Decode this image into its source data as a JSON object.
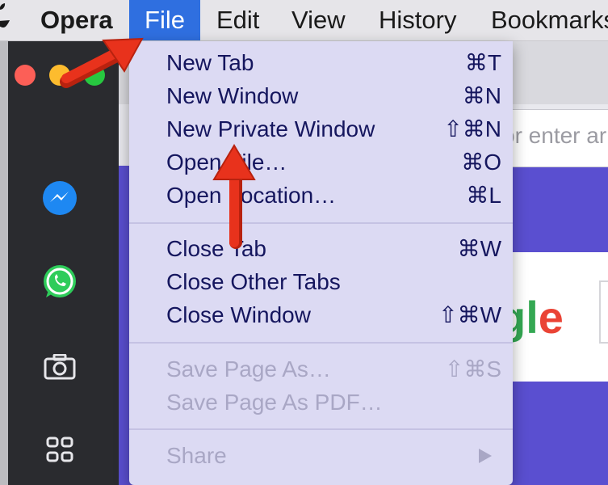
{
  "menubar": {
    "apple": "",
    "app_name": "Opera",
    "items": [
      "File",
      "Edit",
      "View",
      "History",
      "Bookmarks"
    ]
  },
  "address_bar": {
    "text": "or enter ar"
  },
  "google_logo_partial": {
    "g": "g",
    "l": "l",
    "e": "e"
  },
  "file_menu": {
    "group1": [
      {
        "label": "New Tab",
        "shortcut": "⌘T"
      },
      {
        "label": "New Window",
        "shortcut": "⌘N"
      },
      {
        "label": "New Private Window",
        "shortcut": "⇧⌘N"
      },
      {
        "label": "Open File…",
        "shortcut": "⌘O"
      },
      {
        "label": "Open Location…",
        "shortcut": "⌘L"
      }
    ],
    "group2": [
      {
        "label": "Close Tab",
        "shortcut": "⌘W"
      },
      {
        "label": "Close Other Tabs",
        "shortcut": ""
      },
      {
        "label": "Close Window",
        "shortcut": "⇧⌘W"
      }
    ],
    "group3": [
      {
        "label": "Save Page As…",
        "shortcut": "⇧⌘S"
      },
      {
        "label": "Save Page As PDF…",
        "shortcut": ""
      }
    ],
    "group4": [
      {
        "label": "Share",
        "shortcut": ""
      }
    ]
  },
  "colors": {
    "menu_highlight": "#2f6fe0",
    "annotation_arrow": "#e8321c",
    "menu_text": "#15165e",
    "disabled_text": "#a9a7c5"
  },
  "icons": [
    "apple-icon",
    "messenger-icon",
    "whatsapp-icon",
    "camera-icon",
    "apps-grid-icon",
    "submenu-arrow-icon"
  ]
}
